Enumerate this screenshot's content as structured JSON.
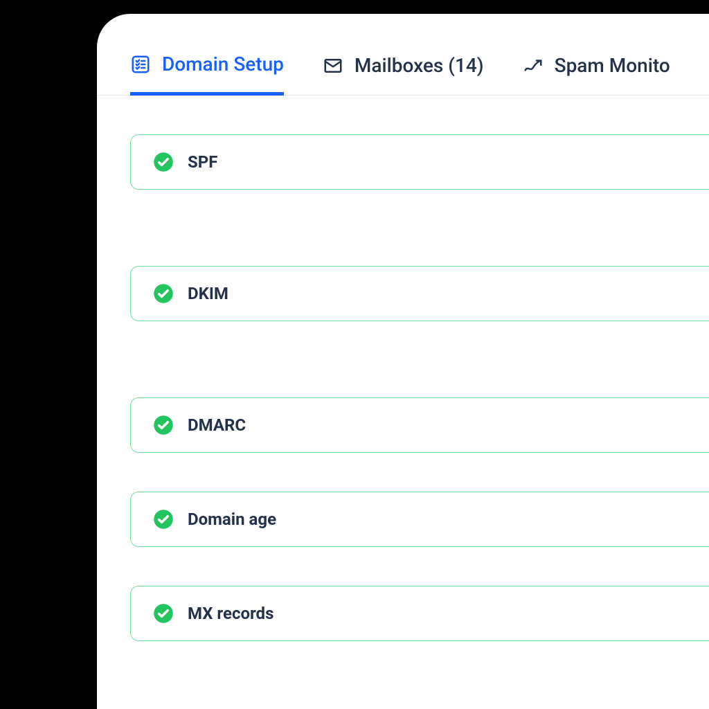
{
  "colors": {
    "accent": "#1760ff",
    "text": "#23324a",
    "success_border": "#6fe3a2",
    "success_fill": "#22c55e"
  },
  "tabs": [
    {
      "label": "Domain Setup",
      "icon": "checklist-icon",
      "active": true
    },
    {
      "label": "Mailboxes (14)",
      "icon": "mail-icon",
      "active": false
    },
    {
      "label": "Spam Monito",
      "icon": "trend-up-icon",
      "active": false
    }
  ],
  "checks": [
    {
      "label": "SPF",
      "status": "success"
    },
    {
      "label": "DKIM",
      "status": "success"
    },
    {
      "label": "DMARC",
      "status": "success"
    },
    {
      "label": "Domain age",
      "status": "success"
    },
    {
      "label": "MX records",
      "status": "success"
    }
  ]
}
